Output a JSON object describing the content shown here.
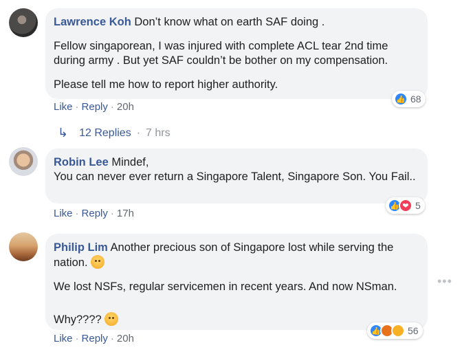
{
  "comments": [
    {
      "author": "Lawrence Koh",
      "lines": [
        " Don’t know what on earth SAF doing .",
        "Fellow singaporean, I was injured with complete ACL tear 2nd time during army . But yet SAF couldn’t be bother on my compensation.",
        "Please tell me how to report higher authority."
      ],
      "like": "Like",
      "reply": "Reply",
      "time": "20h",
      "reaction_count": "68"
    },
    {
      "author": "Robin Lee",
      "lines": [
        " Mindef,",
        "You can never ever return a Singapore Talent, Singapore Son. You Fail.."
      ],
      "like": "Like",
      "reply": "Reply",
      "time": "17h",
      "reaction_count": "5"
    },
    {
      "author": "Philip Lim",
      "lines": [
        " Another precious son of Singapore lost while serving the nation. ",
        "We lost NSFs, regular servicemen in recent years. And now NSman.",
        "Why???? "
      ],
      "like": "Like",
      "reply": "Reply",
      "time": "20h",
      "reaction_count": "56"
    }
  ],
  "replies": {
    "label": "12 Replies",
    "time": "7 hrs"
  },
  "sep": "·",
  "colors": {
    "author": "#385898",
    "bubble": "#f2f3f5",
    "like": "#2d88ff",
    "love": "#f33e58"
  }
}
